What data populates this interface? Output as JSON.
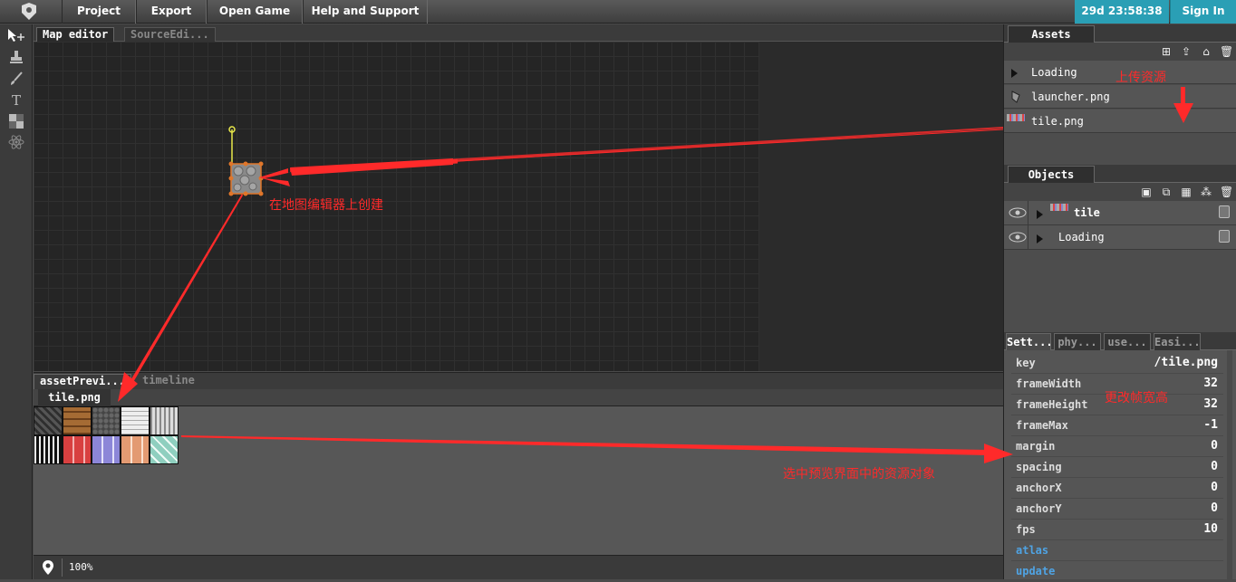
{
  "menu": {
    "items": [
      "Project",
      "Export",
      "Open Game",
      "Help and Support"
    ],
    "timer": "29d 23:58:38",
    "signin": "Sign In"
  },
  "map": {
    "tabs": [
      "Map editor",
      "SourceEdi..."
    ]
  },
  "preview": {
    "tabs": [
      "assetPrevi...",
      "timeline"
    ],
    "asset_title": "tile.png",
    "zoom": "100%"
  },
  "assets": {
    "tab": "Assets",
    "items": [
      "Loading",
      "launcher.png",
      "tile.png"
    ]
  },
  "objects": {
    "tab": "Objects",
    "items": [
      "tile",
      "Loading"
    ]
  },
  "settings": {
    "tabs": [
      "Sett...",
      "phy...",
      "use...",
      "Easi..."
    ],
    "props": [
      {
        "key": "key",
        "value": "/tile.png"
      },
      {
        "key": "frameWidth",
        "value": "32"
      },
      {
        "key": "frameHeight",
        "value": "32"
      },
      {
        "key": "frameMax",
        "value": "-1"
      },
      {
        "key": "margin",
        "value": "0"
      },
      {
        "key": "spacing",
        "value": "0"
      },
      {
        "key": "anchorX",
        "value": "0"
      },
      {
        "key": "anchorY",
        "value": "0"
      },
      {
        "key": "fps",
        "value": "10"
      }
    ],
    "links": [
      "atlas",
      "update"
    ]
  },
  "annotations": {
    "upload": "上传资源",
    "create": "在地图编辑器上创建",
    "change": "更改帧宽高",
    "select": "选中预览界面中的资源对象"
  },
  "colors": {
    "accent": "#2a9fb5",
    "annotation": "#ff2a2a",
    "link": "#4fa3e3"
  }
}
